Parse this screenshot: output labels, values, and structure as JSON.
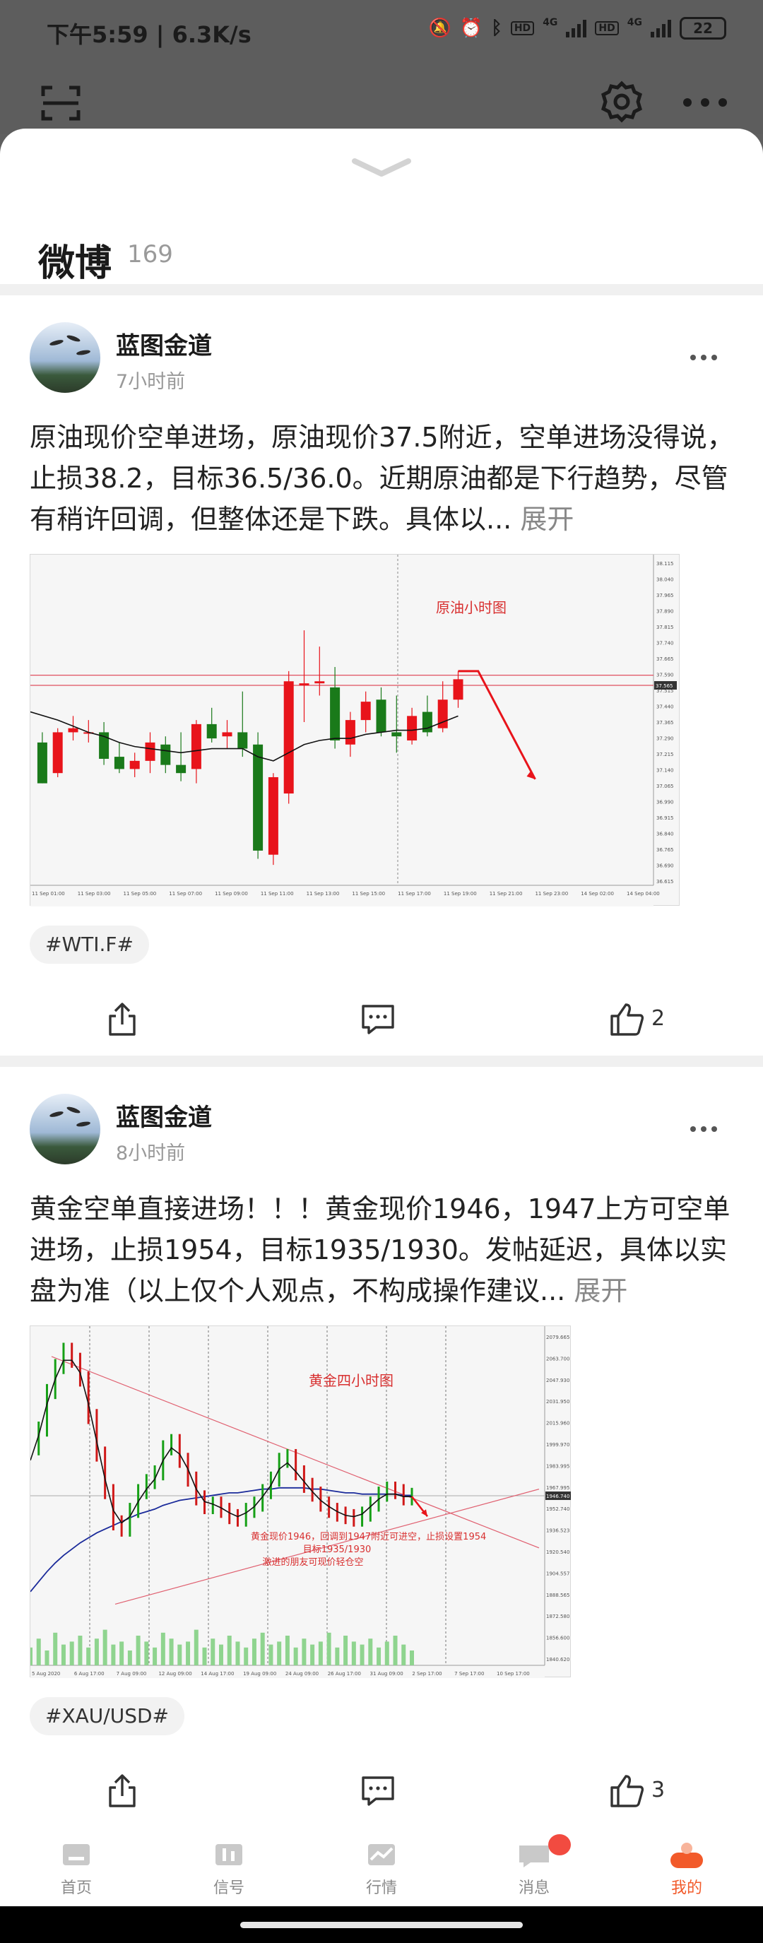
{
  "status": {
    "time": "下午5:59 | 6.3K/s",
    "battery": "22",
    "net1": "4G",
    "net2": "4G",
    "hd": "HD"
  },
  "sheet": {
    "title": "微博",
    "count": "169"
  },
  "posts": [
    {
      "author": "蓝图金道",
      "time": "7小时前",
      "text": "原油现价空单进场，原油现价37.5附近，空单进场没得说，止损38.2，目标36.5/36.0。近期原油都是下行趋势，尽管有稍许回调，但整体还是下跌。具体以...",
      "expand": "展开",
      "tag": "#WTI.F#",
      "likes": "2",
      "chart_data": {
        "type": "candlestick",
        "title": "原油小时图",
        "ylim": [
          36.55,
          38.15
        ],
        "yticks": [
          "38.115",
          "38.040",
          "37.965",
          "37.890",
          "37.815",
          "37.740",
          "37.665",
          "37.590",
          "37.515",
          "37.440",
          "37.365",
          "37.290",
          "37.215",
          "37.140",
          "37.065",
          "36.990",
          "36.915",
          "36.840",
          "36.765",
          "36.690",
          "36.615"
        ],
        "current_price_label": "37.565",
        "xticks": [
          "11 Sep 01:00",
          "11 Sep 03:00",
          "11 Sep 05:00",
          "11 Sep 07:00",
          "11 Sep 09:00",
          "11 Sep 11:00",
          "11 Sep 13:00",
          "11 Sep 15:00",
          "11 Sep 17:00",
          "11 Sep 19:00",
          "11 Sep 21:00",
          "11 Sep 23:00",
          "14 Sep 02:00",
          "14 Sep 04:00"
        ],
        "candles": [
          {
            "o": 37.25,
            "h": 37.3,
            "l": 37.05,
            "c": 37.05
          },
          {
            "o": 37.1,
            "h": 37.32,
            "l": 37.08,
            "c": 37.3
          },
          {
            "o": 37.3,
            "h": 37.38,
            "l": 37.26,
            "c": 37.32
          },
          {
            "o": 37.3,
            "h": 37.36,
            "l": 37.25,
            "c": 37.3
          },
          {
            "o": 37.3,
            "h": 37.35,
            "l": 37.14,
            "c": 37.17
          },
          {
            "o": 37.18,
            "h": 37.25,
            "l": 37.1,
            "c": 37.12
          },
          {
            "o": 37.12,
            "h": 37.2,
            "l": 37.08,
            "c": 37.16
          },
          {
            "o": 37.16,
            "h": 37.3,
            "l": 37.1,
            "c": 37.25
          },
          {
            "o": 37.24,
            "h": 37.28,
            "l": 37.1,
            "c": 37.14
          },
          {
            "o": 37.14,
            "h": 37.3,
            "l": 37.06,
            "c": 37.1
          },
          {
            "o": 37.12,
            "h": 37.36,
            "l": 37.05,
            "c": 37.34
          },
          {
            "o": 37.34,
            "h": 37.42,
            "l": 37.25,
            "c": 37.27
          },
          {
            "o": 37.28,
            "h": 37.36,
            "l": 37.22,
            "c": 37.3
          },
          {
            "o": 37.3,
            "h": 37.5,
            "l": 37.18,
            "c": 37.22
          },
          {
            "o": 37.24,
            "h": 37.3,
            "l": 36.68,
            "c": 36.72
          },
          {
            "o": 36.7,
            "h": 37.1,
            "l": 36.65,
            "c": 37.08
          },
          {
            "o": 37.0,
            "h": 37.6,
            "l": 36.95,
            "c": 37.55
          },
          {
            "o": 37.53,
            "h": 37.8,
            "l": 37.35,
            "c": 37.54
          },
          {
            "o": 37.54,
            "h": 37.72,
            "l": 37.48,
            "c": 37.55
          },
          {
            "o": 37.52,
            "h": 37.62,
            "l": 37.22,
            "c": 37.26
          },
          {
            "o": 37.24,
            "h": 37.4,
            "l": 37.18,
            "c": 37.36
          },
          {
            "o": 37.36,
            "h": 37.5,
            "l": 37.3,
            "c": 37.45
          },
          {
            "o": 37.46,
            "h": 37.52,
            "l": 37.28,
            "c": 37.3
          },
          {
            "o": 37.3,
            "h": 37.48,
            "l": 37.2,
            "c": 37.28
          },
          {
            "o": 37.26,
            "h": 37.42,
            "l": 37.24,
            "c": 37.38
          },
          {
            "o": 37.4,
            "h": 37.48,
            "l": 37.28,
            "c": 37.3
          },
          {
            "o": 37.32,
            "h": 37.55,
            "l": 37.3,
            "c": 37.46
          },
          {
            "o": 37.46,
            "h": 37.6,
            "l": 37.42,
            "c": 37.56
          }
        ],
        "ma": [
          37.4,
          37.36,
          37.33,
          37.3,
          37.28,
          37.25,
          37.23,
          37.22,
          37.21,
          37.2,
          37.21,
          37.22,
          37.22,
          37.22,
          37.18,
          37.16,
          37.2,
          37.24,
          37.26,
          37.27,
          37.27,
          37.29,
          37.3,
          37.31,
          37.31,
          37.32,
          37.35,
          37.38
        ],
        "resistance_lines": [
          37.58,
          37.53
        ],
        "arrow_path": [
          [
            27.5,
            37.6
          ],
          [
            28.8,
            37.6
          ],
          [
            32.5,
            37.07
          ]
        ]
      }
    },
    {
      "author": "蓝图金道",
      "time": "8小时前",
      "text": "黄金空单直接进场！！！黄金现价1946，1947上方可空单进场，止损1954，目标1935/1930。发帖延迟，具体以实盘为准（以上仅个人观点，不构成操作建议...",
      "expand": "展开",
      "tag": "#XAU/USD#",
      "likes": "3",
      "chart_data": {
        "type": "line",
        "title": "黄金四小时图",
        "annotation": [
          "黄金现价1946，回调到1947附近可进空，止损设置1954",
          "目标1935/1930",
          "激进的朋友可现价轻仓空"
        ],
        "ylim": [
          1845,
          2080
        ],
        "yticks": [
          "2079.665",
          "2063.700",
          "2047.930",
          "2031.950",
          "2015.960",
          "1999.970",
          "1983.995",
          "1967.995",
          "1952.740",
          "1936.523",
          "1920.540",
          "1904.557",
          "1888.565",
          "1872.580",
          "1856.600",
          "1840.620"
        ],
        "current_price_label": "1946.740",
        "xticks": [
          "5 Aug 2020",
          "6 Aug 17:00",
          "7 Aug 09:00",
          "12 Aug 09:00",
          "14 Aug 17:00",
          "19 Aug 09:00",
          "24 Aug 09:00",
          "26 Aug 17:00",
          "31 Aug 09:00",
          "2 Sep 17:00",
          "7 Sep 17:00",
          "10 Sep 17:00"
        ],
        "price": [
          1985,
          2000,
          2030,
          2050,
          2063,
          2055,
          2040,
          2010,
          1980,
          1950,
          1925,
          1920,
          1935,
          1950,
          1958,
          1965,
          1985,
          1990,
          1975,
          1960,
          1945,
          1938,
          1940,
          1935,
          1930,
          1928,
          1935,
          1940,
          1950,
          1960,
          1975,
          1978,
          1965,
          1955,
          1948,
          1940,
          1935,
          1932,
          1930,
          1928,
          1932,
          1940,
          1948,
          1952,
          1950,
          1945,
          1947
        ],
        "ma_short": [
          1975,
          1995,
          2020,
          2040,
          2055,
          2055,
          2045,
          2020,
          1990,
          1960,
          1935,
          1925,
          1930,
          1942,
          1952,
          1960,
          1975,
          1985,
          1980,
          1968,
          1952,
          1942,
          1940,
          1937,
          1933,
          1930,
          1933,
          1938,
          1946,
          1955,
          1968,
          1973,
          1966,
          1958,
          1950,
          1943,
          1938,
          1934,
          1931,
          1930,
          1932,
          1938,
          1944,
          1948,
          1948,
          1946,
          1946
        ],
        "ma_long": [
          1870,
          1878,
          1886,
          1893,
          1899,
          1904,
          1909,
          1913,
          1917,
          1920,
          1923,
          1926,
          1929,
          1932,
          1934,
          1936,
          1939,
          1941,
          1943,
          1944,
          1945,
          1946,
          1947,
          1948,
          1949,
          1949,
          1950,
          1951,
          1952,
          1952,
          1953,
          1953,
          1953,
          1953,
          1952,
          1952,
          1951,
          1950,
          1949,
          1949,
          1948,
          1948,
          1948,
          1948,
          1948,
          1947,
          1947
        ],
        "trend_upper": [
          [
            3,
            2058
          ],
          [
            47,
            1945
          ],
          [
            72,
            1905
          ]
        ],
        "trend_lower": [
          [
            12,
            1860
          ],
          [
            72,
            1952
          ]
        ],
        "volume": [
          6,
          9,
          5,
          11,
          7,
          8,
          10,
          6,
          9,
          12,
          7,
          8,
          5,
          10,
          8,
          6,
          11,
          9,
          7,
          8,
          12,
          6,
          9,
          7,
          10,
          8,
          6,
          9,
          11,
          7,
          8,
          10,
          6,
          9,
          7,
          8,
          11,
          6,
          10,
          8,
          7,
          9,
          6,
          8,
          10,
          7,
          5
        ]
      }
    }
  ],
  "nav": [
    {
      "label": "首页",
      "icon": "home-icon"
    },
    {
      "label": "信号",
      "icon": "signal-icon"
    },
    {
      "label": "行情",
      "icon": "market-icon"
    },
    {
      "label": "消息",
      "icon": "message-icon"
    },
    {
      "label": "我的",
      "icon": "profile-icon"
    }
  ],
  "colors": {
    "accent": "#f25a2a",
    "up": "#e8141b",
    "down": "#1a7a1a",
    "badge": "#f24b40"
  }
}
